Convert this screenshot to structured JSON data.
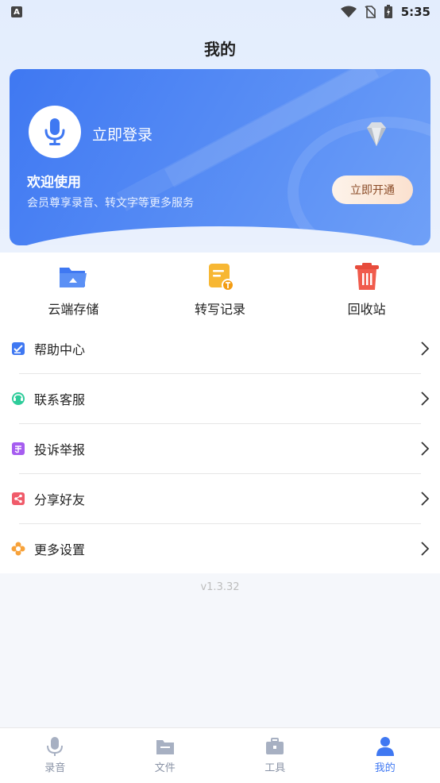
{
  "status_bar": {
    "time": "5:35",
    "indicator": "A"
  },
  "header": {
    "title": "我的"
  },
  "banner": {
    "login_text": "立即登录",
    "welcome_title": "欢迎使用",
    "welcome_subtitle": "会员尊享录音、转文字等更多服务",
    "vip_button": "立即开通"
  },
  "quick_actions": [
    {
      "label": "云端存储",
      "icon": "cloud-folder-icon"
    },
    {
      "label": "转写记录",
      "icon": "transcript-record-icon"
    },
    {
      "label": "回收站",
      "icon": "trash-icon"
    }
  ],
  "menu": [
    {
      "label": "帮助中心",
      "icon": "help-icon"
    },
    {
      "label": "联系客服",
      "icon": "customer-service-icon"
    },
    {
      "label": "投诉举报",
      "icon": "complaint-icon"
    },
    {
      "label": "分享好友",
      "icon": "share-icon"
    },
    {
      "label": "更多设置",
      "icon": "settings-icon"
    }
  ],
  "version": "v1.3.32",
  "tabbar": [
    {
      "label": "录音",
      "icon": "microphone-icon"
    },
    {
      "label": "文件",
      "icon": "folder-icon"
    },
    {
      "label": "工具",
      "icon": "toolbox-icon"
    },
    {
      "label": "我的",
      "icon": "person-icon",
      "active": true
    }
  ],
  "colors": {
    "primary": "#3f78f2",
    "tab_inactive": "#8a93a6"
  }
}
